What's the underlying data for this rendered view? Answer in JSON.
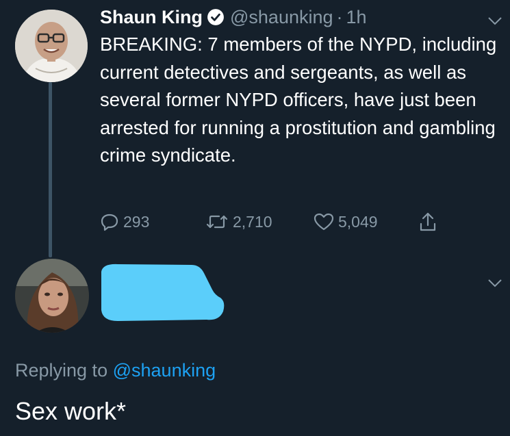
{
  "tweet": {
    "display_name": "Shaun King",
    "handle": "@shaunking",
    "separator": "·",
    "time": "1h",
    "text": "BREAKING: 7 members of the NYPD, including current detectives and sergeants, as well as several former NYPD officers, have just been arrested for running a prostitution and gambling crime syndicate.",
    "reply_count": "293",
    "retweet_count": "2,710",
    "like_count": "5,049"
  },
  "reply": {
    "replying_prefix": "Replying to",
    "replying_to": "@shaunking",
    "text": "Sex work*"
  },
  "icons": {
    "verified": "verified-badge-icon",
    "reply": "reply-bubble-icon",
    "retweet": "retweet-icon",
    "like": "heart-icon",
    "share": "share-icon",
    "menu": "chevron-down-icon"
  },
  "colors": {
    "background": "#15202b",
    "secondary_text": "#8899a6",
    "link": "#1da1f2",
    "redaction": "#5bcefa"
  }
}
